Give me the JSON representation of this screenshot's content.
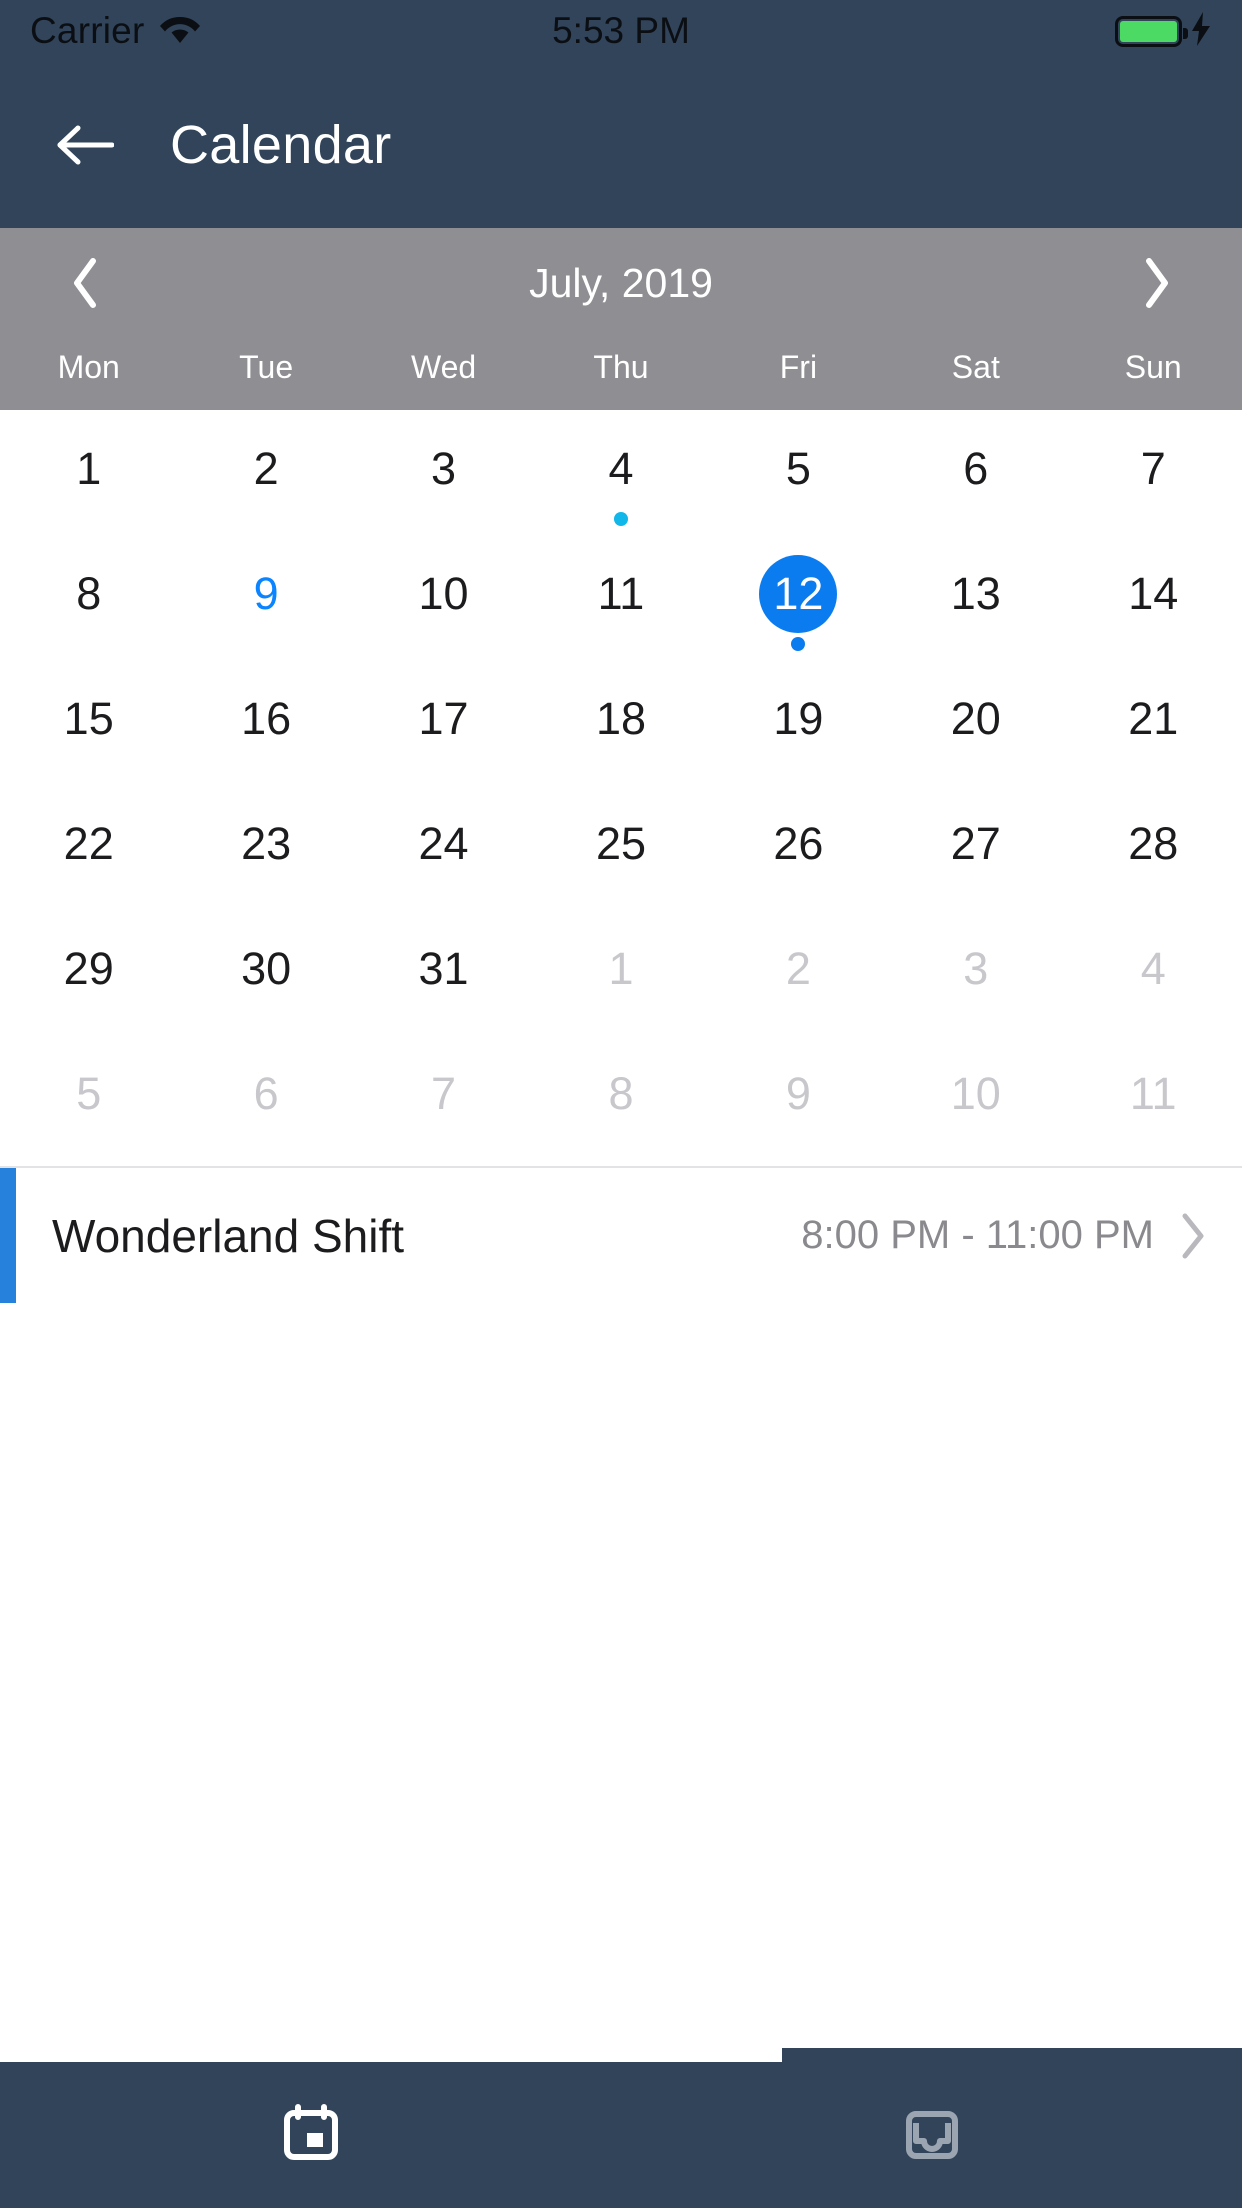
{
  "status_bar": {
    "carrier": "Carrier",
    "time": "5:53 PM",
    "wifi_icon": "wifi-icon",
    "battery_icon": "battery-full-icon",
    "charging_icon": "lightning-bolt-icon",
    "battery_color": "#4CD964"
  },
  "nav": {
    "back_icon": "arrow-left-icon",
    "title": "Calendar",
    "background_color": "#32445A"
  },
  "month_header": {
    "prev_icon": "chevron-left-icon",
    "next_icon": "chevron-right-icon",
    "label": "July, 2019",
    "background_color": "#8E8E93",
    "weekdays": [
      "Mon",
      "Tue",
      "Wed",
      "Thu",
      "Fri",
      "Sat",
      "Sun"
    ]
  },
  "calendar": {
    "accent_color": "#0A7CF0",
    "today_color": "#0A84FF",
    "event_dot_color": "#11B7E8",
    "selected_dot_color": "#0A7CF0",
    "other_month_color": "#C7C7CC",
    "weeks": [
      [
        {
          "num": "1",
          "month": "current",
          "state": "normal"
        },
        {
          "num": "2",
          "month": "current",
          "state": "normal"
        },
        {
          "num": "3",
          "month": "current",
          "state": "normal"
        },
        {
          "num": "4",
          "month": "current",
          "state": "normal",
          "dot": "#11B7E8"
        },
        {
          "num": "5",
          "month": "current",
          "state": "normal"
        },
        {
          "num": "6",
          "month": "current",
          "state": "normal"
        },
        {
          "num": "7",
          "month": "current",
          "state": "normal"
        }
      ],
      [
        {
          "num": "8",
          "month": "current",
          "state": "normal"
        },
        {
          "num": "9",
          "month": "current",
          "state": "today"
        },
        {
          "num": "10",
          "month": "current",
          "state": "normal"
        },
        {
          "num": "11",
          "month": "current",
          "state": "normal"
        },
        {
          "num": "12",
          "month": "current",
          "state": "selected",
          "dot": "#0A7CF0"
        },
        {
          "num": "13",
          "month": "current",
          "state": "normal"
        },
        {
          "num": "14",
          "month": "current",
          "state": "normal"
        }
      ],
      [
        {
          "num": "15",
          "month": "current",
          "state": "normal"
        },
        {
          "num": "16",
          "month": "current",
          "state": "normal"
        },
        {
          "num": "17",
          "month": "current",
          "state": "normal"
        },
        {
          "num": "18",
          "month": "current",
          "state": "normal"
        },
        {
          "num": "19",
          "month": "current",
          "state": "normal"
        },
        {
          "num": "20",
          "month": "current",
          "state": "normal"
        },
        {
          "num": "21",
          "month": "current",
          "state": "normal"
        }
      ],
      [
        {
          "num": "22",
          "month": "current",
          "state": "normal"
        },
        {
          "num": "23",
          "month": "current",
          "state": "normal"
        },
        {
          "num": "24",
          "month": "current",
          "state": "normal"
        },
        {
          "num": "25",
          "month": "current",
          "state": "normal"
        },
        {
          "num": "26",
          "month": "current",
          "state": "normal"
        },
        {
          "num": "27",
          "month": "current",
          "state": "normal"
        },
        {
          "num": "28",
          "month": "current",
          "state": "normal"
        }
      ],
      [
        {
          "num": "29",
          "month": "current",
          "state": "normal"
        },
        {
          "num": "30",
          "month": "current",
          "state": "normal"
        },
        {
          "num": "31",
          "month": "current",
          "state": "normal"
        },
        {
          "num": "1",
          "month": "next",
          "state": "other"
        },
        {
          "num": "2",
          "month": "next",
          "state": "other"
        },
        {
          "num": "3",
          "month": "next",
          "state": "other"
        },
        {
          "num": "4",
          "month": "next",
          "state": "other"
        }
      ],
      [
        {
          "num": "5",
          "month": "next",
          "state": "other"
        },
        {
          "num": "6",
          "month": "next",
          "state": "other"
        },
        {
          "num": "7",
          "month": "next",
          "state": "other"
        },
        {
          "num": "8",
          "month": "next",
          "state": "other"
        },
        {
          "num": "9",
          "month": "next",
          "state": "other"
        },
        {
          "num": "10",
          "month": "next",
          "state": "other"
        },
        {
          "num": "11",
          "month": "next",
          "state": "other"
        }
      ]
    ]
  },
  "events": [
    {
      "title": "Wonderland Shift",
      "time": "8:00 PM - 11:00 PM",
      "accent_color": "#2681DC",
      "chevron_icon": "chevron-right-icon"
    }
  ],
  "scroll_indicator": {
    "thumb_width_percent": 63
  },
  "tab_bar": {
    "background_color": "#32445A",
    "items": [
      {
        "icon": "calendar-icon",
        "active": true,
        "color": "#FFFFFF"
      },
      {
        "icon": "inbox-icon",
        "active": false,
        "color": "#9AA5B1"
      }
    ]
  }
}
